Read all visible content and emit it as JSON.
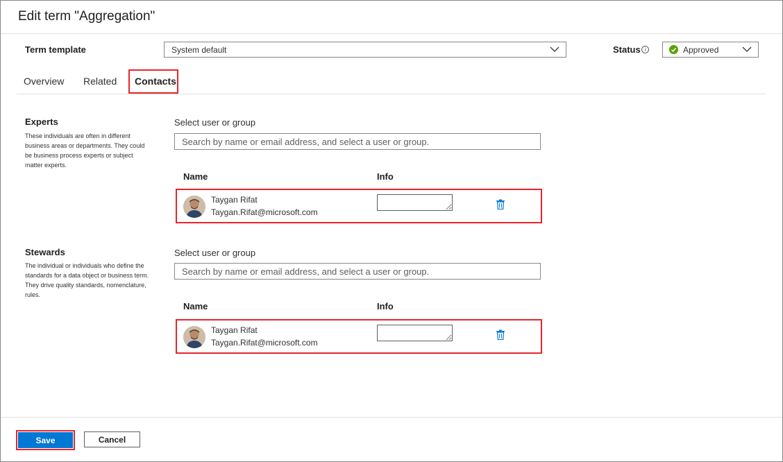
{
  "dialog": {
    "title": "Edit term \"Aggregation\""
  },
  "term_template": {
    "label": "Term template",
    "value": "System default"
  },
  "status": {
    "label": "Status",
    "info_icon": "info-icon",
    "value": "Approved",
    "status_color": "#57a300"
  },
  "tabs": [
    {
      "label": "Overview",
      "active": false
    },
    {
      "label": "Related",
      "active": false
    },
    {
      "label": "Contacts",
      "active": true
    }
  ],
  "experts": {
    "title": "Experts",
    "description": "These individuals are often in different business areas or departments. They could be business process experts or subject matter experts.",
    "select_label": "Select user or group",
    "search_placeholder": "Search by name or email address, and select a user or group.",
    "col_name": "Name",
    "col_info": "Info",
    "rows": [
      {
        "name": "Taygan Rifat",
        "email": "Taygan.Rifat@microsoft.com",
        "info": "",
        "delete_icon": "trash-icon"
      }
    ]
  },
  "stewards": {
    "title": "Stewards",
    "description": "The individual or individuals who define the standards for a data object or business term. They drive quality standards, nomenclature, rules.",
    "select_label": "Select user or group",
    "search_placeholder": "Search by name or email address, and select a user or group.",
    "col_name": "Name",
    "col_info": "Info",
    "rows": [
      {
        "name": "Taygan Rifat",
        "email": "Taygan.Rifat@microsoft.com",
        "info": "",
        "delete_icon": "trash-icon"
      }
    ]
  },
  "footer": {
    "save_label": "Save",
    "cancel_label": "Cancel"
  },
  "colors": {
    "accent": "#0078d4",
    "highlight": "#e8242c"
  }
}
